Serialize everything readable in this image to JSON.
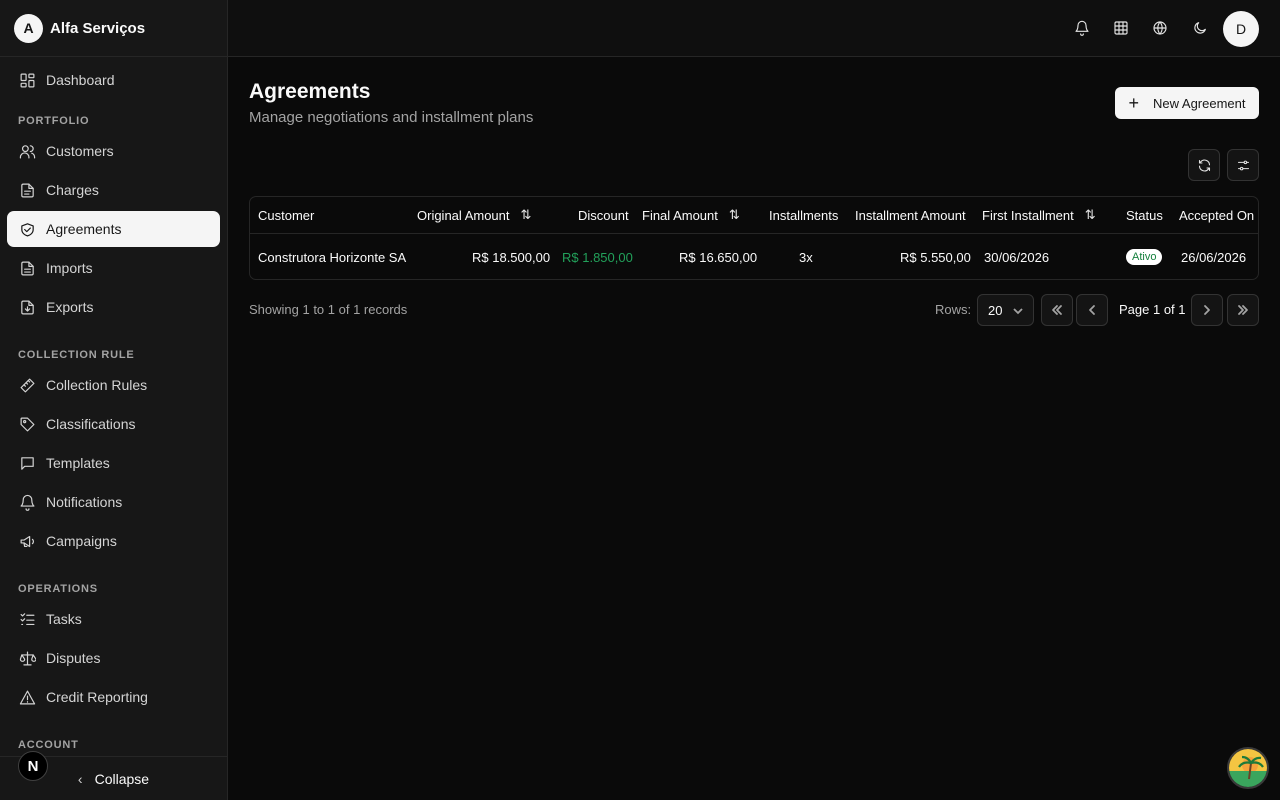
{
  "brand": {
    "initial": "A",
    "name": "Alfa Serviços"
  },
  "sidebar": {
    "dashboard": {
      "label": "Dashboard",
      "icon": "dashboard-icon"
    },
    "sections": [
      {
        "title": "PORTFOLIO",
        "items": [
          {
            "label": "Customers",
            "icon": "users-icon"
          },
          {
            "label": "Charges",
            "icon": "file-text-icon"
          },
          {
            "label": "Agreements",
            "icon": "handshake-icon",
            "active": true
          },
          {
            "label": "Imports",
            "icon": "file-import-icon"
          },
          {
            "label": "Exports",
            "icon": "file-export-icon"
          }
        ]
      },
      {
        "title": "COLLECTION RULE",
        "items": [
          {
            "label": "Collection Rules",
            "icon": "ruler-icon"
          },
          {
            "label": "Classifications",
            "icon": "tag-icon"
          },
          {
            "label": "Templates",
            "icon": "message-square-icon"
          },
          {
            "label": "Notifications",
            "icon": "bell-icon"
          },
          {
            "label": "Campaigns",
            "icon": "megaphone-icon"
          }
        ]
      },
      {
        "title": "OPERATIONS",
        "items": [
          {
            "label": "Tasks",
            "icon": "list-checks-icon"
          },
          {
            "label": "Disputes",
            "icon": "scale-icon"
          },
          {
            "label": "Credit Reporting",
            "icon": "alert-triangle-icon"
          }
        ]
      },
      {
        "title": "ACCOUNT",
        "items": []
      }
    ],
    "collapse_label": "Collapse",
    "n_badge": "N"
  },
  "topbar": {
    "icons": [
      "bell-icon",
      "grid-icon",
      "globe-icon",
      "moon-icon"
    ],
    "user_initial": "D"
  },
  "page": {
    "title": "Agreements",
    "subtitle": "Manage negotiations and installment plans",
    "new_button": "New Agreement"
  },
  "table": {
    "columns": [
      "Customer",
      "Original Amount",
      "Discount",
      "Final Amount",
      "Installments",
      "Installment Amount",
      "First Installment",
      "Status",
      "Accepted On"
    ],
    "rows": [
      {
        "customer": "Construtora Horizonte SA",
        "original_amount": "R$ 18.500,00",
        "discount": "R$ 1.850,00",
        "final_amount": "R$ 16.650,00",
        "installments": "3x",
        "installment_amount": "R$ 5.550,00",
        "first_installment": "30/06/2026",
        "status": "Ativo",
        "accepted_on": "26/06/2026"
      }
    ]
  },
  "pagination": {
    "records_text": "Showing 1 to 1 of 1 records",
    "rows_label": "Rows:",
    "rows_value": "20",
    "page_text": "Page 1 of 1"
  },
  "colors": {
    "accent_green": "#22a05a",
    "background": "#0a0a0a",
    "sidebar": "#171717"
  }
}
